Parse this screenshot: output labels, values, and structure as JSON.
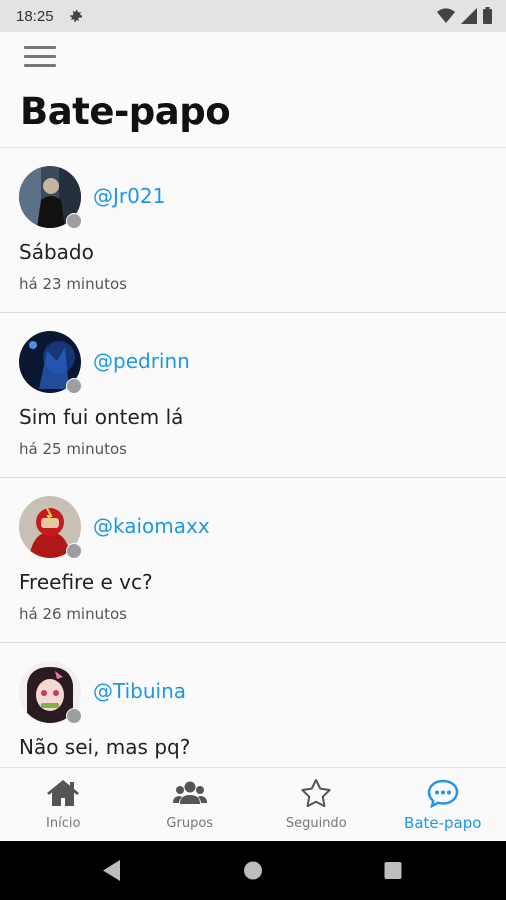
{
  "status_bar": {
    "time": "18:25"
  },
  "header": {
    "title": "Bate-papo"
  },
  "chats": [
    {
      "username": "@Jr021",
      "message": "Sábado",
      "time": "há 23 minutos"
    },
    {
      "username": "@pedrinn",
      "message": "Sim fui ontem lá",
      "time": "há 25 minutos"
    },
    {
      "username": "@kaiomaxx",
      "message": "Freefire e vc?",
      "time": "há 26 minutos"
    },
    {
      "username": "@Tibuina",
      "message": "Não sei, mas pq?",
      "time": ""
    }
  ],
  "bottom_nav": [
    {
      "label": "Início",
      "icon": "home-icon",
      "active": false
    },
    {
      "label": "Grupos",
      "icon": "group-icon",
      "active": false
    },
    {
      "label": "Seguindo",
      "icon": "star-icon",
      "active": false
    },
    {
      "label": "Bate-papo",
      "icon": "chat-icon",
      "active": true
    }
  ],
  "colors": {
    "accent": "#1e96e6",
    "presence_offline": "#9e9e9e",
    "status_bar": "#e3e3e3"
  }
}
